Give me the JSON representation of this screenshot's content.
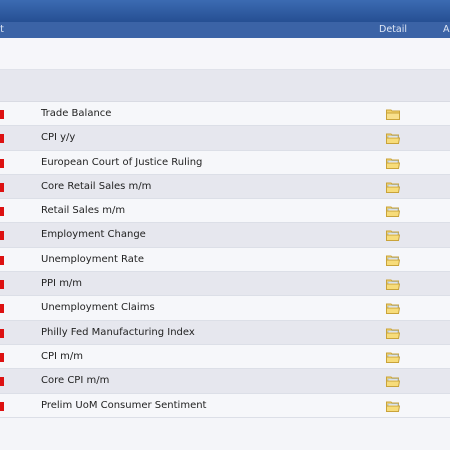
{
  "header": {
    "impact_label": "pact",
    "detail_label": "Detail",
    "actual_label": "A"
  },
  "colors": {
    "header_bg": "#3b63a6",
    "impact_high": "#dd1111"
  },
  "events": [
    {
      "name": "Trade Balance",
      "impact": "high",
      "detail_icon": "folder-icon"
    },
    {
      "name": "CPI y/y",
      "impact": "high",
      "detail_icon": "folder-open-icon"
    },
    {
      "name": "European Court of Justice Ruling",
      "impact": "high",
      "detail_icon": "folder-open-icon"
    },
    {
      "name": "Core Retail Sales m/m",
      "impact": "high",
      "detail_icon": "folder-open-icon"
    },
    {
      "name": "Retail Sales m/m",
      "impact": "high",
      "detail_icon": "folder-open-icon"
    },
    {
      "name": "Employment Change",
      "impact": "high",
      "detail_icon": "folder-open-icon"
    },
    {
      "name": "Unemployment Rate",
      "impact": "high",
      "detail_icon": "folder-open-icon"
    },
    {
      "name": "PPI m/m",
      "impact": "high",
      "detail_icon": "folder-open-icon"
    },
    {
      "name": "Unemployment Claims",
      "impact": "high",
      "detail_icon": "folder-open-icon"
    },
    {
      "name": "Philly Fed Manufacturing Index",
      "impact": "high",
      "detail_icon": "folder-open-icon"
    },
    {
      "name": "CPI m/m",
      "impact": "high",
      "detail_icon": "folder-open-icon"
    },
    {
      "name": "Core CPI m/m",
      "impact": "high",
      "detail_icon": "folder-open-icon"
    },
    {
      "name": "Prelim UoM Consumer Sentiment",
      "impact": "high",
      "detail_icon": "folder-open-icon"
    }
  ]
}
